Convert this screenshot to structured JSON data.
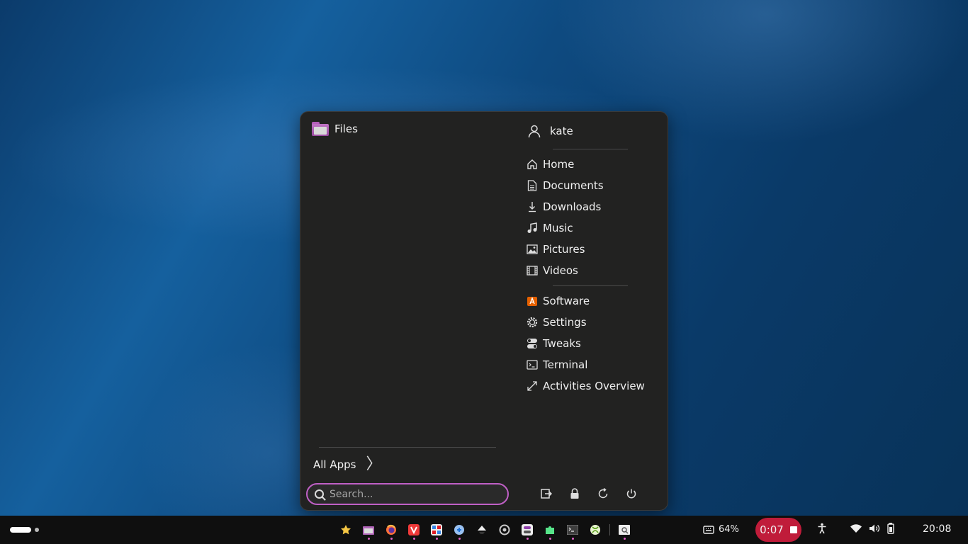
{
  "menu": {
    "pinned": [
      {
        "label": "Files",
        "icon": "folder-icon"
      }
    ],
    "all_apps_label": "All Apps",
    "search": {
      "placeholder": "Search...",
      "value": ""
    },
    "user": {
      "name": "kate",
      "icon": "user-icon"
    },
    "places": [
      {
        "label": "Home",
        "icon": "home-icon"
      },
      {
        "label": "Documents",
        "icon": "document-icon"
      },
      {
        "label": "Downloads",
        "icon": "download-icon"
      },
      {
        "label": "Music",
        "icon": "music-icon"
      },
      {
        "label": "Pictures",
        "icon": "picture-icon"
      },
      {
        "label": "Videos",
        "icon": "video-icon"
      }
    ],
    "apps": [
      {
        "label": "Software",
        "icon": "software-icon"
      },
      {
        "label": "Settings",
        "icon": "gear-icon"
      },
      {
        "label": "Tweaks",
        "icon": "toggle-icon"
      },
      {
        "label": "Terminal",
        "icon": "terminal-icon"
      },
      {
        "label": "Activities Overview",
        "icon": "expand-icon"
      }
    ],
    "session_buttons": [
      "logout-icon",
      "lock-icon",
      "restart-icon",
      "power-icon"
    ],
    "search_color": "#c060c6"
  },
  "taskbar": {
    "battery_percent": "64%",
    "recording_time": "0:07",
    "clock": "20:08",
    "recording_color": "#c01c3a"
  }
}
